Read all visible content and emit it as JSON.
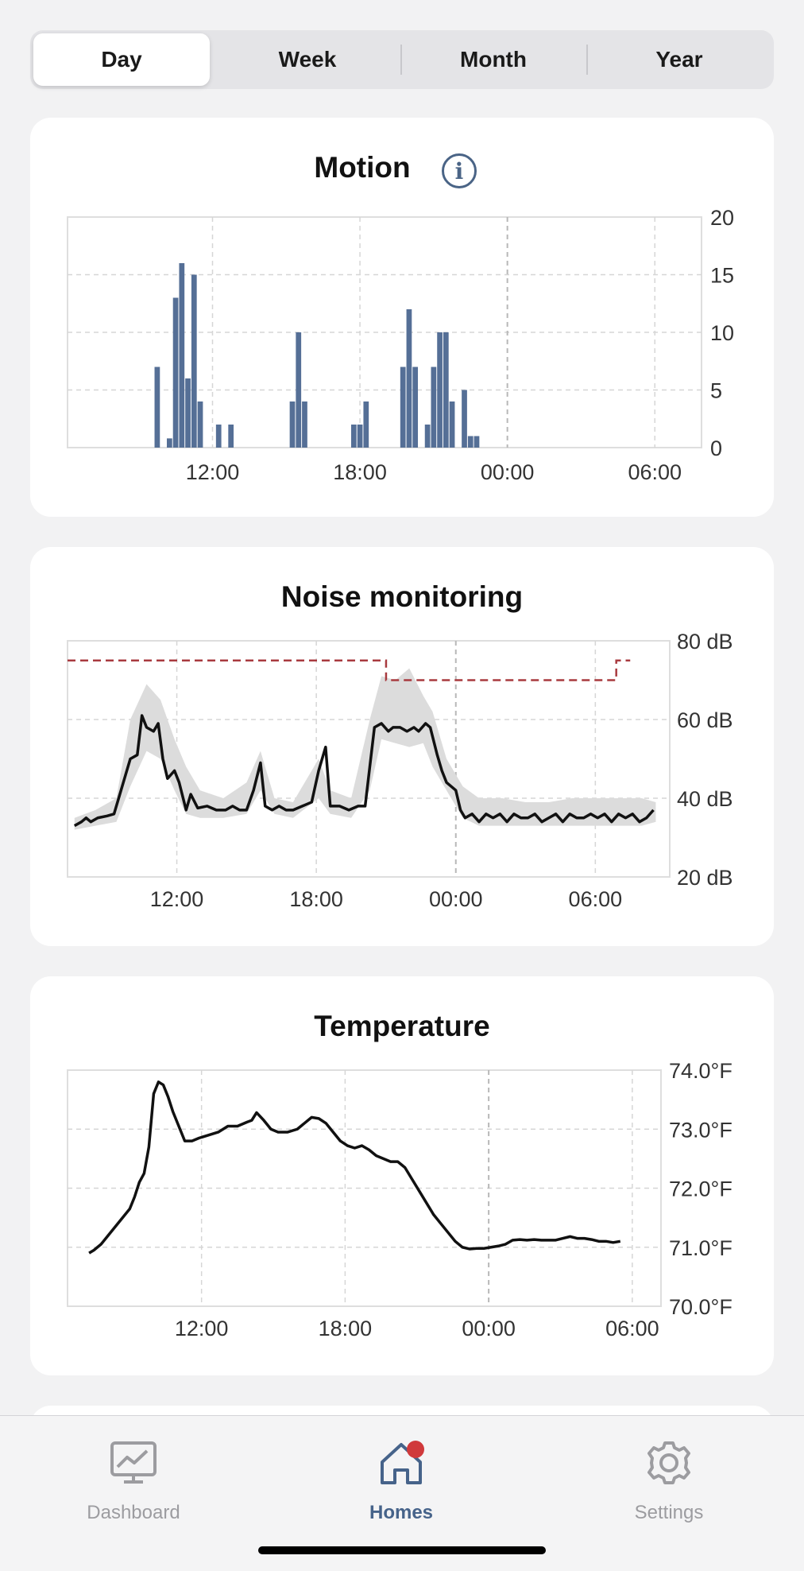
{
  "segments": [
    {
      "label": "Day",
      "active": true
    },
    {
      "label": "Week",
      "active": false
    },
    {
      "label": "Month",
      "active": false
    },
    {
      "label": "Year",
      "active": false
    }
  ],
  "cards": {
    "motion": {
      "title": "Motion",
      "info_icon": "info-icon"
    },
    "noise": {
      "title": "Noise monitoring"
    },
    "temperature": {
      "title": "Temperature"
    }
  },
  "colors": {
    "accent": "#46638a",
    "bar": "#556f96",
    "badge": "#d0393b",
    "threshold": "#a83a3f",
    "band": "#dcdcdc"
  },
  "chart_data": [
    {
      "type": "bar",
      "title": "Motion",
      "x_unit": "hour",
      "x_range": [
        7.9,
        8.5
      ],
      "x_ticks": [
        "12:00",
        "18:00",
        "00:00",
        "06:00"
      ],
      "x_tick_hours": [
        12,
        18,
        24,
        30
      ],
      "y_ticks": [
        "20",
        "15",
        "10",
        "5",
        "0"
      ],
      "ylim": [
        0,
        20
      ],
      "grid": true,
      "bar_width_hours": 0.25,
      "bars": [
        {
          "h": 9.75,
          "v": 7
        },
        {
          "h": 10.25,
          "v": 0.8
        },
        {
          "h": 10.5,
          "v": 13
        },
        {
          "h": 10.75,
          "v": 16
        },
        {
          "h": 11.0,
          "v": 6
        },
        {
          "h": 11.25,
          "v": 15
        },
        {
          "h": 11.5,
          "v": 4
        },
        {
          "h": 12.25,
          "v": 2
        },
        {
          "h": 12.75,
          "v": 2
        },
        {
          "h": 15.25,
          "v": 4
        },
        {
          "h": 15.5,
          "v": 10
        },
        {
          "h": 15.75,
          "v": 4
        },
        {
          "h": 17.75,
          "v": 2
        },
        {
          "h": 18.0,
          "v": 2
        },
        {
          "h": 18.25,
          "v": 4
        },
        {
          "h": 19.75,
          "v": 7
        },
        {
          "h": 20.0,
          "v": 12
        },
        {
          "h": 20.25,
          "v": 7
        },
        {
          "h": 20.75,
          "v": 2
        },
        {
          "h": 21.0,
          "v": 7
        },
        {
          "h": 21.25,
          "v": 10
        },
        {
          "h": 21.5,
          "v": 10
        },
        {
          "h": 21.75,
          "v": 4
        },
        {
          "h": 22.25,
          "v": 5
        },
        {
          "h": 22.5,
          "v": 1
        },
        {
          "h": 22.75,
          "v": 1
        }
      ]
    },
    {
      "type": "line",
      "title": "Noise monitoring",
      "x_ticks": [
        "12:00",
        "18:00",
        "00:00",
        "06:00"
      ],
      "x_tick_hours": [
        12,
        18,
        24,
        30
      ],
      "xlim": [
        7.3,
        31.5
      ],
      "y_ticks": [
        "80 dB",
        "60 dB",
        "40 dB",
        "20 dB"
      ],
      "ylim": [
        20,
        80
      ],
      "grid": true,
      "series": [
        {
          "style": "solid",
          "points": [
            [
              7.6,
              33
            ],
            [
              7.9,
              34
            ],
            [
              8.1,
              35
            ],
            [
              8.3,
              34
            ],
            [
              8.6,
              35
            ],
            [
              9.0,
              35.5
            ],
            [
              9.3,
              36
            ],
            [
              9.5,
              40
            ],
            [
              9.8,
              46
            ],
            [
              10.0,
              50
            ],
            [
              10.3,
              51
            ],
            [
              10.5,
              61
            ],
            [
              10.7,
              58
            ],
            [
              11.0,
              57
            ],
            [
              11.2,
              59
            ],
            [
              11.4,
              50
            ],
            [
              11.6,
              45
            ],
            [
              11.9,
              47
            ],
            [
              12.1,
              44
            ],
            [
              12.4,
              37
            ],
            [
              12.6,
              41
            ],
            [
              12.9,
              37.5
            ],
            [
              13.3,
              38
            ],
            [
              13.7,
              37
            ],
            [
              14.1,
              37
            ],
            [
              14.4,
              38
            ],
            [
              14.7,
              37
            ],
            [
              15.0,
              37
            ],
            [
              15.3,
              42
            ],
            [
              15.6,
              49
            ],
            [
              15.8,
              38
            ],
            [
              16.1,
              37
            ],
            [
              16.4,
              38
            ],
            [
              16.7,
              37
            ],
            [
              17.0,
              37
            ],
            [
              17.4,
              38
            ],
            [
              17.8,
              39
            ],
            [
              18.1,
              47
            ],
            [
              18.4,
              53
            ],
            [
              18.6,
              38
            ],
            [
              19.0,
              38
            ],
            [
              19.4,
              37
            ],
            [
              19.8,
              38
            ],
            [
              20.1,
              38
            ],
            [
              20.3,
              48
            ],
            [
              20.5,
              58
            ],
            [
              20.8,
              59
            ],
            [
              21.1,
              57
            ],
            [
              21.3,
              58
            ],
            [
              21.6,
              58
            ],
            [
              21.9,
              57
            ],
            [
              22.2,
              58
            ],
            [
              22.4,
              57
            ],
            [
              22.7,
              59
            ],
            [
              22.9,
              58
            ],
            [
              23.2,
              51
            ],
            [
              23.4,
              47
            ],
            [
              23.6,
              44
            ],
            [
              24.0,
              42
            ],
            [
              24.2,
              37
            ],
            [
              24.4,
              35
            ],
            [
              24.7,
              36
            ],
            [
              25.0,
              34
            ],
            [
              25.3,
              36
            ],
            [
              25.6,
              35
            ],
            [
              25.9,
              36
            ],
            [
              26.2,
              34
            ],
            [
              26.5,
              36
            ],
            [
              26.8,
              35
            ],
            [
              27.1,
              35
            ],
            [
              27.4,
              36
            ],
            [
              27.7,
              34
            ],
            [
              28.0,
              35
            ],
            [
              28.3,
              36
            ],
            [
              28.6,
              34
            ],
            [
              28.9,
              36
            ],
            [
              29.2,
              35
            ],
            [
              29.5,
              35
            ],
            [
              29.8,
              36
            ],
            [
              30.1,
              35
            ],
            [
              30.4,
              36
            ],
            [
              30.7,
              34
            ],
            [
              31.0,
              36
            ],
            [
              31.3,
              35
            ],
            [
              31.6,
              36
            ],
            [
              31.9,
              34
            ],
            [
              32.2,
              35
            ],
            [
              32.5,
              37
            ]
          ]
        },
        {
          "style": "dashed",
          "points": [
            [
              7.3,
              75
            ],
            [
              21.0,
              75
            ],
            [
              21.0,
              70
            ],
            [
              30.9,
              70
            ],
            [
              30.9,
              75
            ],
            [
              31.5,
              75
            ]
          ]
        }
      ],
      "band": {
        "upper": [
          [
            7.6,
            35
          ],
          [
            8.5,
            37
          ],
          [
            9.4,
            40
          ],
          [
            10.0,
            60
          ],
          [
            10.7,
            69
          ],
          [
            11.3,
            65
          ],
          [
            11.9,
            55
          ],
          [
            12.4,
            48
          ],
          [
            13.0,
            42
          ],
          [
            14.0,
            40
          ],
          [
            15.0,
            44
          ],
          [
            15.6,
            52
          ],
          [
            16.2,
            40
          ],
          [
            17.0,
            39
          ],
          [
            18.1,
            50
          ],
          [
            18.6,
            42
          ],
          [
            19.5,
            40
          ],
          [
            20.3,
            60
          ],
          [
            20.8,
            71
          ],
          [
            21.4,
            70
          ],
          [
            22.0,
            73
          ],
          [
            22.6,
            66
          ],
          [
            23.0,
            62
          ],
          [
            23.6,
            50
          ],
          [
            24.3,
            43
          ],
          [
            25.0,
            40
          ],
          [
            26.0,
            40
          ],
          [
            27.0,
            39
          ],
          [
            28.0,
            39
          ],
          [
            29.0,
            40
          ],
          [
            30.0,
            40
          ],
          [
            31.0,
            40
          ],
          [
            32.0,
            40
          ],
          [
            32.6,
            39
          ]
        ],
        "lower": [
          [
            7.6,
            32
          ],
          [
            8.5,
            33
          ],
          [
            9.4,
            34
          ],
          [
            10.0,
            43
          ],
          [
            10.7,
            52
          ],
          [
            11.3,
            50
          ],
          [
            11.9,
            42
          ],
          [
            12.4,
            36
          ],
          [
            13.0,
            35
          ],
          [
            14.0,
            35
          ],
          [
            15.0,
            36
          ],
          [
            15.6,
            42
          ],
          [
            16.2,
            36
          ],
          [
            17.0,
            35
          ],
          [
            18.1,
            40
          ],
          [
            18.6,
            36
          ],
          [
            19.5,
            35
          ],
          [
            20.3,
            42
          ],
          [
            20.8,
            55
          ],
          [
            21.4,
            54
          ],
          [
            22.0,
            53
          ],
          [
            22.6,
            54
          ],
          [
            23.0,
            48
          ],
          [
            23.6,
            42
          ],
          [
            24.3,
            35
          ],
          [
            25.0,
            33
          ],
          [
            26.0,
            33
          ],
          [
            27.0,
            33
          ],
          [
            28.0,
            33
          ],
          [
            29.0,
            33
          ],
          [
            30.0,
            33
          ],
          [
            31.0,
            33
          ],
          [
            32.0,
            33
          ],
          [
            32.6,
            34
          ]
        ]
      }
    },
    {
      "type": "line",
      "title": "Temperature",
      "x_ticks": [
        "12:00",
        "18:00",
        "00:00",
        "06:00"
      ],
      "x_tick_hours": [
        12,
        18,
        24,
        30
      ],
      "y_ticks": [
        "74.0°F",
        "73.0°F",
        "72.0°F",
        "71.0°F",
        "70.0°F"
      ],
      "ylim": [
        70,
        74
      ],
      "grid": true,
      "series": [
        {
          "style": "solid",
          "points": [
            [
              7.3,
              70.9
            ],
            [
              7.5,
              70.95
            ],
            [
              7.8,
              71.05
            ],
            [
              8.1,
              71.2
            ],
            [
              8.4,
              71.35
            ],
            [
              8.7,
              71.5
            ],
            [
              9.0,
              71.65
            ],
            [
              9.2,
              71.85
            ],
            [
              9.4,
              72.1
            ],
            [
              9.6,
              72.25
            ],
            [
              9.8,
              72.7
            ],
            [
              10.0,
              73.6
            ],
            [
              10.2,
              73.8
            ],
            [
              10.4,
              73.75
            ],
            [
              10.6,
              73.55
            ],
            [
              10.8,
              73.3
            ],
            [
              11.1,
              73.0
            ],
            [
              11.3,
              72.8
            ],
            [
              11.6,
              72.8
            ],
            [
              11.9,
              72.85
            ],
            [
              12.3,
              72.9
            ],
            [
              12.7,
              72.95
            ],
            [
              13.1,
              73.05
            ],
            [
              13.5,
              73.05
            ],
            [
              13.9,
              73.12
            ],
            [
              14.1,
              73.15
            ],
            [
              14.3,
              73.28
            ],
            [
              14.6,
              73.15
            ],
            [
              14.9,
              73.0
            ],
            [
              15.2,
              72.95
            ],
            [
              15.6,
              72.95
            ],
            [
              16.0,
              73.0
            ],
            [
              16.3,
              73.1
            ],
            [
              16.6,
              73.2
            ],
            [
              16.9,
              73.18
            ],
            [
              17.2,
              73.1
            ],
            [
              17.5,
              72.95
            ],
            [
              17.8,
              72.8
            ],
            [
              18.1,
              72.72
            ],
            [
              18.4,
              72.68
            ],
            [
              18.7,
              72.72
            ],
            [
              19.0,
              72.65
            ],
            [
              19.3,
              72.55
            ],
            [
              19.6,
              72.5
            ],
            [
              19.9,
              72.45
            ],
            [
              20.2,
              72.45
            ],
            [
              20.5,
              72.35
            ],
            [
              20.8,
              72.15
            ],
            [
              21.1,
              71.95
            ],
            [
              21.4,
              71.75
            ],
            [
              21.7,
              71.55
            ],
            [
              22.0,
              71.4
            ],
            [
              22.3,
              71.25
            ],
            [
              22.6,
              71.1
            ],
            [
              22.9,
              71.0
            ],
            [
              23.2,
              70.97
            ],
            [
              23.5,
              70.98
            ],
            [
              23.8,
              70.98
            ],
            [
              24.1,
              71.0
            ],
            [
              24.4,
              71.02
            ],
            [
              24.7,
              71.05
            ],
            [
              25.0,
              71.12
            ],
            [
              25.3,
              71.13
            ],
            [
              25.6,
              71.12
            ],
            [
              25.9,
              71.13
            ],
            [
              26.2,
              71.12
            ],
            [
              26.5,
              71.12
            ],
            [
              26.8,
              71.12
            ],
            [
              27.1,
              71.15
            ],
            [
              27.4,
              71.18
            ],
            [
              27.7,
              71.15
            ],
            [
              28.0,
              71.15
            ],
            [
              28.3,
              71.13
            ],
            [
              28.6,
              71.1
            ],
            [
              28.9,
              71.1
            ],
            [
              29.2,
              71.08
            ],
            [
              29.5,
              71.1
            ]
          ]
        }
      ]
    }
  ],
  "tabbar": {
    "items": [
      {
        "label": "Dashboard",
        "icon": "dashboard-chart-icon",
        "active": false
      },
      {
        "label": "Homes",
        "icon": "home-icon",
        "active": true,
        "badge": true
      },
      {
        "label": "Settings",
        "icon": "gear-icon",
        "active": false
      }
    ]
  }
}
